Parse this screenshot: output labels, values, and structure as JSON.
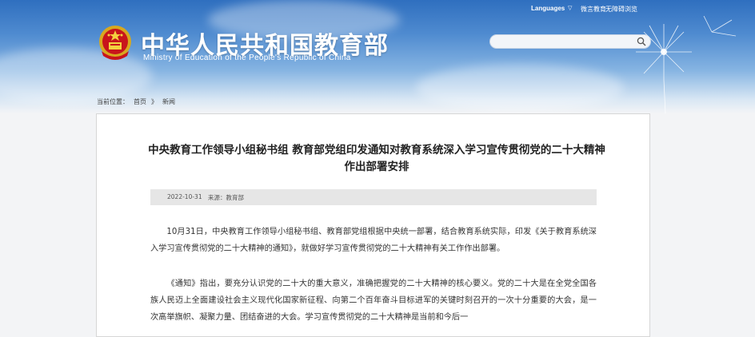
{
  "header": {
    "site_title": "中华人民共和国教育部",
    "site_subtitle": "Ministry of Education of the People's Republic of China",
    "top_nav": {
      "languages": "Languages",
      "caret": "▽",
      "link_weibo": "微言教育",
      "link_accessibility": "无障碍浏览"
    },
    "search": {
      "placeholder": "",
      "value": ""
    }
  },
  "breadcrumb": {
    "label": "当前位置：",
    "home": "首页",
    "separator": "》",
    "current": "新闻"
  },
  "article": {
    "title": "中央教育工作领导小组秘书组 教育部党组印发通知对教育系统深入学习宣传贯彻党的二十大精神作出部署安排",
    "date": "2022-10-31",
    "source": "来源：教育部",
    "paragraphs": [
      "10月31日，中央教育工作领导小组秘书组、教育部党组根据中央统一部署，结合教育系统实际，印发《关于教育系统深入学习宣传贯彻党的二十大精神的通知》，就做好学习宣传贯彻党的二十大精神有关工作作出部署。",
      "《通知》指出，要充分认识党的二十大的重大意义，准确把握党的二十大精神的核心要义。党的二十大是在全党全国各族人民迈上全面建设社会主义现代化国家新征程、向第二个百年奋斗目标进军的关键时刻召开的一次十分重要的大会，是一次高举旗帜、凝聚力量、团结奋进的大会。学习宣传贯彻党的二十大精神是当前和今后一"
    ]
  },
  "colors": {
    "header_top": "#2f6fbf",
    "page_bg": "#f3f4f6",
    "meta_bar": "#e6e6e6"
  },
  "icons": {
    "emblem": "national-emblem-icon",
    "search": "search-icon"
  }
}
